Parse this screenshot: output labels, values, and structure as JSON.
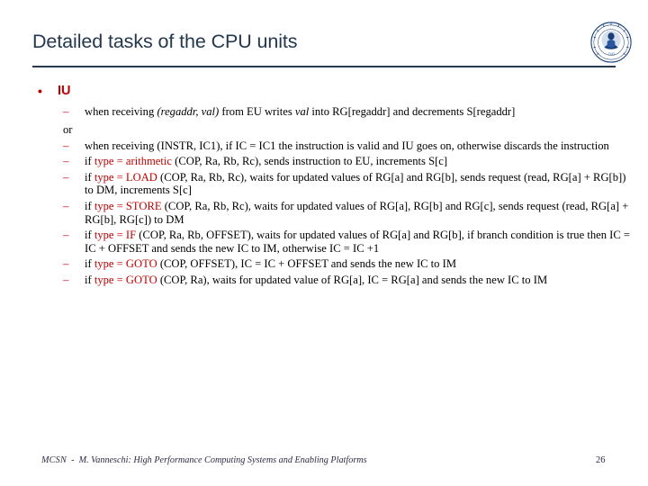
{
  "slide": {
    "title": "Detailed tasks of the CPU units",
    "logo_name": "university-of-pisa-seal",
    "accent_color": "#c00000",
    "title_color": "#23384e",
    "rule_color": "#26394f"
  },
  "content": {
    "section_label": "IU",
    "bullet_glyph": "•",
    "dash_glyph": "–",
    "connector": "or",
    "items": [
      {
        "id": "item-write-back",
        "parts": [
          {
            "text": "when receiving ",
            "style": "plain"
          },
          {
            "text": "(regaddr, val)",
            "style": "italic"
          },
          {
            "text": " from EU writes ",
            "style": "plain"
          },
          {
            "text": "val",
            "style": "italic"
          },
          {
            "text": " into RG[regaddr] and decrements S[regaddr]",
            "style": "plain"
          }
        ]
      },
      {
        "id": "item-instr-validate",
        "parts": [
          {
            "text": "when receiving (INSTR, IC1), if IC = IC1 the instruction is valid and IU goes on, otherwise discards the instruction",
            "style": "plain"
          }
        ]
      },
      {
        "id": "item-arithmetic",
        "parts": [
          {
            "text": "if ",
            "style": "plain"
          },
          {
            "text": "type = arithmetic",
            "style": "red"
          },
          {
            "text": " (COP, Ra, Rb, Rc), sends instruction to EU, increments S[c]",
            "style": "plain"
          }
        ]
      },
      {
        "id": "item-load",
        "parts": [
          {
            "text": "if ",
            "style": "plain"
          },
          {
            "text": "type = LOAD",
            "style": "red"
          },
          {
            "text": " (COP, Ra, Rb, Rc), waits for updated values of RG[a] and RG[b], sends request (read, RG[a] + RG[b]) to DM, increments S[c]",
            "style": "plain"
          }
        ]
      },
      {
        "id": "item-store",
        "parts": [
          {
            "text": "if ",
            "style": "plain"
          },
          {
            "text": "type = STORE",
            "style": "red"
          },
          {
            "text": " (COP, Ra, Rb, Rc), waits for updated values of RG[a],  RG[b] and RG[c], sends request (read, RG[a] + RG[b], RG[c]) to DM",
            "style": "plain"
          }
        ]
      },
      {
        "id": "item-if",
        "parts": [
          {
            "text": "if ",
            "style": "plain"
          },
          {
            "text": "type = IF",
            "style": "red"
          },
          {
            "text": " (COP, Ra, Rb, OFFSET), waits for updated values of RG[a] and RG[b], if branch condition is true then IC = IC + OFFSET and sends the new IC to IM, otherwise IC = IC +1",
            "style": "plain"
          }
        ]
      },
      {
        "id": "item-goto-offset",
        "parts": [
          {
            "text": "if ",
            "style": "plain"
          },
          {
            "text": "type = GOTO",
            "style": "red"
          },
          {
            "text": " (COP, OFFSET), IC = IC + OFFSET and sends the new IC to IM",
            "style": "plain"
          }
        ]
      },
      {
        "id": "item-goto-reg",
        "parts": [
          {
            "text": "if ",
            "style": "plain"
          },
          {
            "text": "type = GOTO",
            "style": "red"
          },
          {
            "text": " (COP, Ra), waits for updated value of RG[a], IC = RG[a] and sends the new IC to IM",
            "style": "plain"
          }
        ]
      }
    ]
  },
  "footer": {
    "course_code": "MCSN",
    "separator": "-",
    "attribution": "M. Vanneschi: High Performance Computing Systems and Enabling Platforms",
    "page_number": "26"
  }
}
